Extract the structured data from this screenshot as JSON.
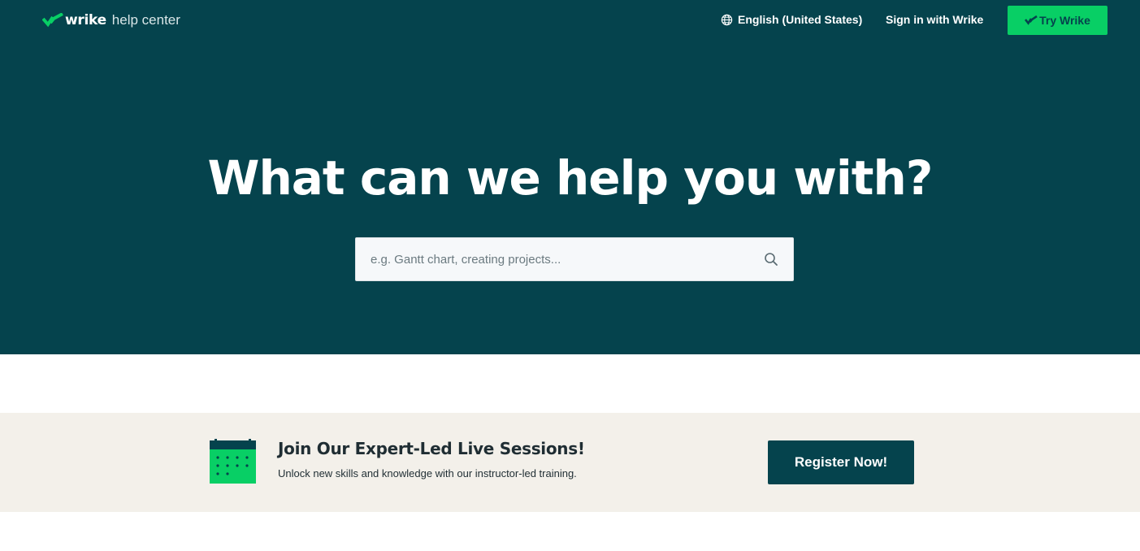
{
  "header": {
    "logo_word": "wrike",
    "logo_sub": "help center",
    "language": "English (United States)",
    "signin_label": "Sign in with Wrike",
    "try_label": "Try Wrike"
  },
  "hero": {
    "title": "What can we help you with?",
    "search_placeholder": "e.g. Gantt chart, creating projects..."
  },
  "banner": {
    "title": "Join Our Expert-Led Live Sessions!",
    "subtitle": "Unlock new skills and knowledge with our instructor-led training.",
    "button_label": "Register Now!"
  },
  "colors": {
    "hero_bg": "#05434d",
    "accent_green": "#08cf65",
    "banner_bg": "#f3f0ea"
  },
  "icons": {
    "logo": "wrike-checkmark-logo-icon",
    "language": "globe-icon",
    "search": "search-icon",
    "banner": "calendar-icon"
  }
}
